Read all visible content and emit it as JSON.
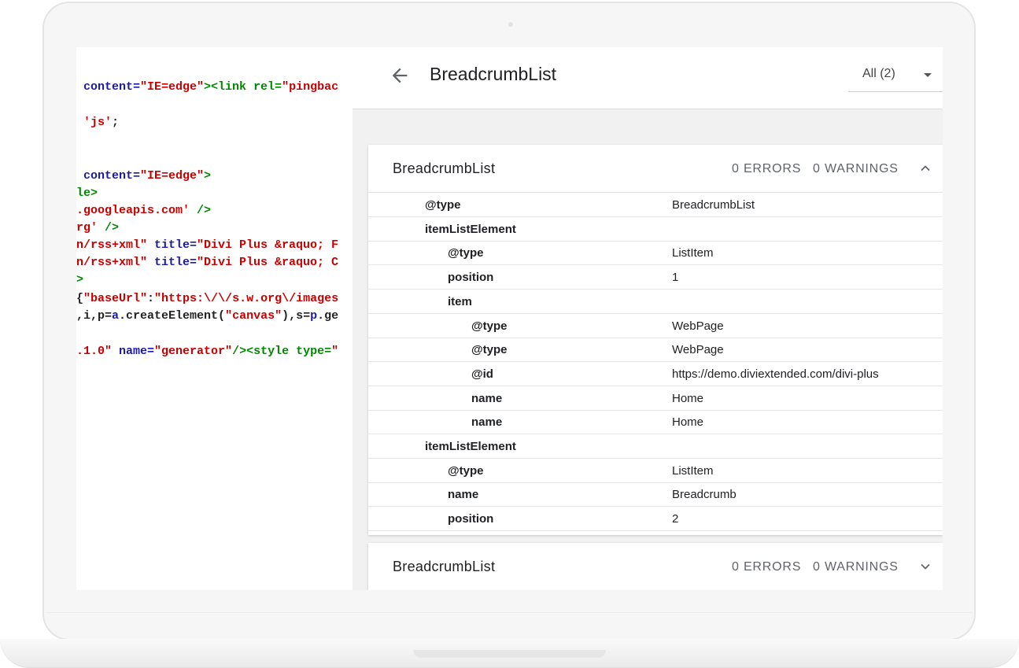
{
  "code_lines": [
    {
      "parts": [
        {
          "t": " content=",
          "c": "c-blue"
        },
        {
          "t": "\"IE=edge\"",
          "c": "c-red"
        },
        {
          "t": "><link rel=",
          "c": "c-green"
        },
        {
          "t": "\"pingbac",
          "c": "c-red"
        }
      ]
    },
    {
      "parts": [
        {
          "t": " 'js'",
          "c": "c-red"
        },
        {
          "t": ";",
          "c": "c-black"
        }
      ]
    },
    {
      "parts": [
        {
          "t": " content=",
          "c": "c-blue"
        },
        {
          "t": "\"IE=edge\"",
          "c": "c-red"
        },
        {
          "t": ">",
          "c": "c-green"
        }
      ]
    },
    {
      "parts": [
        {
          "t": "le>",
          "c": "c-green"
        }
      ]
    },
    {
      "parts": [
        {
          "t": ".googleapis.com'",
          "c": "c-red"
        },
        {
          "t": " />",
          "c": "c-green"
        }
      ]
    },
    {
      "parts": [
        {
          "t": "rg'",
          "c": "c-red"
        },
        {
          "t": " />",
          "c": "c-green"
        }
      ]
    },
    {
      "parts": [
        {
          "t": "n/rss+xml\"",
          "c": "c-red"
        },
        {
          "t": " title=",
          "c": "c-blue"
        },
        {
          "t": "\"Divi Plus &raquo; F",
          "c": "c-red"
        }
      ]
    },
    {
      "parts": [
        {
          "t": "n/rss+xml\"",
          "c": "c-red"
        },
        {
          "t": " title=",
          "c": "c-blue"
        },
        {
          "t": "\"Divi Plus &raquo; C",
          "c": "c-red"
        }
      ]
    },
    {
      "parts": [
        {
          "t": ">",
          "c": "c-green"
        }
      ]
    },
    {
      "parts": [
        {
          "t": "{",
          "c": "c-black"
        },
        {
          "t": "\"baseUrl\"",
          "c": "c-red"
        },
        {
          "t": ":",
          "c": "c-black"
        },
        {
          "t": "\"https:\\/\\/s.w.org\\/images",
          "c": "c-red"
        }
      ]
    },
    {
      "parts": [
        {
          "t": ",i,p=",
          "c": "c-black"
        },
        {
          "t": "a",
          "c": "c-blue"
        },
        {
          "t": ".createElement(",
          "c": "c-black"
        },
        {
          "t": "\"canvas\"",
          "c": "c-red"
        },
        {
          "t": "),s=",
          "c": "c-black"
        },
        {
          "t": "p",
          "c": "c-blue"
        },
        {
          "t": ".ge",
          "c": "c-black"
        }
      ]
    },
    {
      "parts": [
        {
          "t": ".1.0\"",
          "c": "c-red"
        },
        {
          "t": " name=",
          "c": "c-blue"
        },
        {
          "t": "\"generator\"",
          "c": "c-red"
        },
        {
          "t": "/><style type=",
          "c": "c-green"
        },
        {
          "t": "\"",
          "c": "c-red"
        }
      ]
    }
  ],
  "header": {
    "title": "BreadcrumbList",
    "filter_label": "All (2)"
  },
  "cards": [
    {
      "title": "BreadcrumbList",
      "errors": "0 ERRORS",
      "warnings": "0 WARNINGS",
      "expanded": true,
      "rows": [
        {
          "level": 1,
          "key": "@type",
          "value": "BreadcrumbList"
        },
        {
          "level": 1,
          "key": "itemListElement",
          "value": ""
        },
        {
          "level": 2,
          "key": "@type",
          "value": "ListItem"
        },
        {
          "level": 2,
          "key": "position",
          "value": "1"
        },
        {
          "level": 2,
          "key": "item",
          "value": ""
        },
        {
          "level": 3,
          "key": "@type",
          "value": "WebPage"
        },
        {
          "level": 3,
          "key": "@type",
          "value": "WebPage"
        },
        {
          "level": 3,
          "key": "@id",
          "value": "https://demo.diviextended.com/divi-plus"
        },
        {
          "level": 3,
          "key": "name",
          "value": "Home"
        },
        {
          "level": 3,
          "key": "name",
          "value": "Home"
        },
        {
          "level": 1,
          "key": "itemListElement",
          "value": ""
        },
        {
          "level": 2,
          "key": "@type",
          "value": "ListItem"
        },
        {
          "level": 2,
          "key": "name",
          "value": "Breadcrumb"
        },
        {
          "level": 2,
          "key": "position",
          "value": "2"
        }
      ]
    },
    {
      "title": "BreadcrumbList",
      "errors": "0 ERRORS",
      "warnings": "0 WARNINGS",
      "expanded": false,
      "rows": []
    }
  ],
  "icons": {
    "back": "arrow-back-icon",
    "filter": "dropdown-caret-icon",
    "collapse": "chevron-up-icon",
    "expand": "chevron-down-icon"
  }
}
